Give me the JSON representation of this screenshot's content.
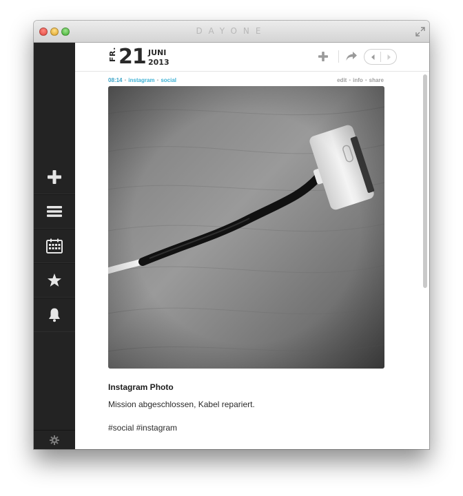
{
  "window": {
    "title": "DAYONE"
  },
  "sidebar": {
    "items": [
      {
        "icon": "plus-icon",
        "action": "new-entry"
      },
      {
        "icon": "list-icon",
        "action": "timeline"
      },
      {
        "icon": "calendar-icon",
        "action": "calendar"
      },
      {
        "icon": "star-icon",
        "action": "starred"
      },
      {
        "icon": "bell-icon",
        "action": "reminders"
      }
    ],
    "footer_icon": "gear-icon"
  },
  "header": {
    "day_of_week": "FR.",
    "day": "21",
    "month": "JUNI",
    "year": "2013",
    "icons": [
      "plus-icon",
      "share-arrow-icon",
      "chevron-left-icon",
      "chevron-right-icon"
    ]
  },
  "meta": {
    "time": "08:14",
    "tags": [
      "instagram",
      "social"
    ],
    "actions": [
      "edit",
      "info",
      "share"
    ]
  },
  "entry": {
    "title": "Instagram Photo",
    "body": "Mission abgeschlossen, Kabel repariert.",
    "tags_text": "#social #instagram"
  },
  "colors": {
    "sidebar_bg": "#232323",
    "accent": "#3db1d4",
    "meta_gray": "#9e9e9e"
  }
}
